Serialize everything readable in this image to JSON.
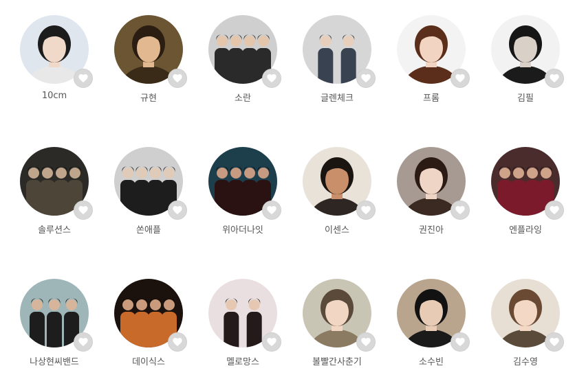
{
  "artists": [
    {
      "name": "10cm",
      "photo": {
        "bg": "#dfe6ee",
        "hair": "#1c1c1c",
        "skin": "#f0d9c8",
        "cloth": "#e8e8e8"
      }
    },
    {
      "name": "규현",
      "photo": {
        "bg": "#6b5532",
        "hair": "#2b1d12",
        "skin": "#e2b890",
        "cloth": "#3a2a18"
      }
    },
    {
      "name": "소란",
      "photo": {
        "bg": "#cfcfcf",
        "hair": "#1a1a1a",
        "skin": "#e4c6ad",
        "cloth": "#2a2a2a"
      }
    },
    {
      "name": "글렌체크",
      "photo": {
        "bg": "#d6d6d6",
        "hair": "#1f1f1f",
        "skin": "#e8cfbb",
        "cloth": "#394250"
      }
    },
    {
      "name": "프롬",
      "photo": {
        "bg": "#f3f3f3",
        "hair": "#5a2e1a",
        "skin": "#f1d4c2",
        "cloth": "#5a2e1a"
      }
    },
    {
      "name": "김필",
      "photo": {
        "bg": "#f2f2f2",
        "hair": "#161616",
        "skin": "#d9d1c8",
        "cloth": "#1b1b1b"
      }
    },
    {
      "name": "솔루션스",
      "photo": {
        "bg": "#2b2a27",
        "hair": "#0f0f0f",
        "skin": "#bfa58c",
        "cloth": "#4d4638"
      }
    },
    {
      "name": "쏜애플",
      "photo": {
        "bg": "#cfcfcf",
        "hair": "#151515",
        "skin": "#e0cbb8",
        "cloth": "#1d1d1d"
      }
    },
    {
      "name": "위아더나잇",
      "photo": {
        "bg": "#1d3f4c",
        "hair": "#0b0b0b",
        "skin": "#c79a82",
        "cloth": "#2a1212"
      }
    },
    {
      "name": "이센스",
      "photo": {
        "bg": "#e9e2d8",
        "hair": "#1a1511",
        "skin": "#c98f6b",
        "cloth": "#2e2622"
      }
    },
    {
      "name": "권진아",
      "photo": {
        "bg": "#a79a92",
        "hair": "#2c1b14",
        "skin": "#eed5c6",
        "cloth": "#3a2a22"
      }
    },
    {
      "name": "엔플라잉",
      "photo": {
        "bg": "#4a2c2c",
        "hair": "#121212",
        "skin": "#cfa38a",
        "cloth": "#7a1a2a"
      }
    },
    {
      "name": "나상현씨밴드",
      "photo": {
        "bg": "#9fb6b8",
        "hair": "#141414",
        "skin": "#d7b59b",
        "cloth": "#1d1d1d"
      }
    },
    {
      "name": "데이식스",
      "photo": {
        "bg": "#1b120d",
        "hair": "#0e0e0e",
        "skin": "#c99b7c",
        "cloth": "#c86a2a"
      }
    },
    {
      "name": "멜로망스",
      "photo": {
        "bg": "#eadfe0",
        "hair": "#141414",
        "skin": "#e6c7b2",
        "cloth": "#241a1a"
      }
    },
    {
      "name": "볼빨간사춘기",
      "photo": {
        "bg": "#c9c5b5",
        "hair": "#5b4a3a",
        "skin": "#f0d6c3",
        "cloth": "#8b7b62"
      }
    },
    {
      "name": "소수빈",
      "photo": {
        "bg": "#b9a48e",
        "hair": "#121212",
        "skin": "#e7cbb5",
        "cloth": "#1a1a1a"
      }
    },
    {
      "name": "김수영",
      "photo": {
        "bg": "#e7dfd3",
        "hair": "#6a4a33",
        "skin": "#f2d8c5",
        "cloth": "#5a4a3a"
      }
    }
  ],
  "colors": {
    "name_text": "#555555",
    "like_button_bg": "#d8d8d8",
    "like_heart": "#ffffff"
  },
  "icons": {
    "like": "heart-icon"
  }
}
